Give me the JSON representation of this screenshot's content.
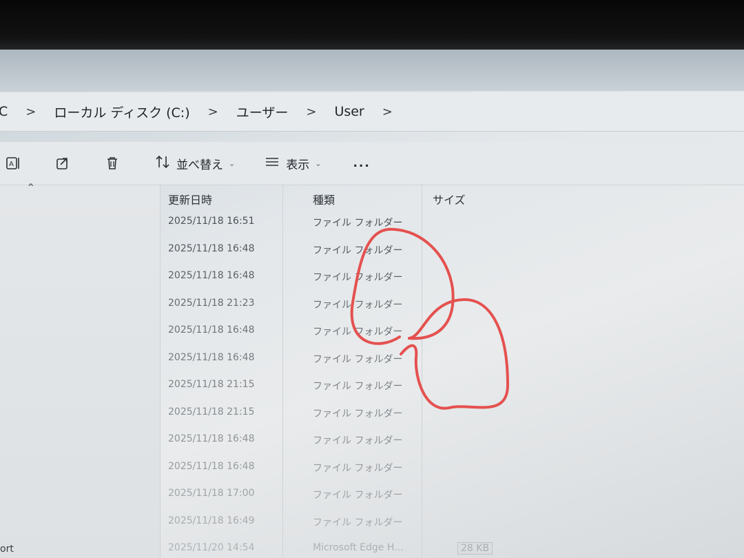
{
  "breadcrumb": {
    "items": [
      "C",
      "ローカル ディスク (C:)",
      "ユーザー",
      "User"
    ],
    "separator": ">"
  },
  "toolbar": {
    "sort_label": "並べ替え",
    "view_label": "表示",
    "more_label": "..."
  },
  "columns": {
    "modified": "更新日時",
    "type": "種類",
    "size": "サイズ"
  },
  "rows": [
    {
      "modified": "2025/11/18 16:51",
      "type": "ファイル フォルダー",
      "size": ""
    },
    {
      "modified": "2025/11/18 16:48",
      "type": "ファイル フォルダー",
      "size": ""
    },
    {
      "modified": "2025/11/18 16:48",
      "type": "ファイル フォルダー",
      "size": ""
    },
    {
      "modified": "2025/11/18 21:23",
      "type": "ファイル フォルダー",
      "size": ""
    },
    {
      "modified": "2025/11/18 16:48",
      "type": "ファイル フォルダー",
      "size": ""
    },
    {
      "modified": "2025/11/18 16:48",
      "type": "ファイル フォルダー",
      "size": ""
    },
    {
      "modified": "2025/11/18 21:15",
      "type": "ファイル フォルダー",
      "size": ""
    },
    {
      "modified": "2025/11/18 21:15",
      "type": "ファイル フォルダー",
      "size": ""
    },
    {
      "modified": "2025/11/18 16:48",
      "type": "ファイル フォルダー",
      "size": ""
    },
    {
      "modified": "2025/11/18 16:48",
      "type": "ファイル フォルダー",
      "size": ""
    },
    {
      "modified": "2025/11/18 17:00",
      "type": "ファイル フォルダー",
      "size": ""
    },
    {
      "modified": "2025/11/18 16:49",
      "type": "ファイル フォルダー",
      "size": ""
    },
    {
      "modified": "2025/11/20 14:54",
      "type": "Microsoft Edge H...",
      "size": "28 KB"
    }
  ],
  "nav": {
    "bottom_label": "ort"
  },
  "colors": {
    "annotation": "#e4514f",
    "text": "#23282d"
  },
  "icons": [
    "rename-icon",
    "share-icon",
    "delete-icon",
    "sort-icon",
    "view-icon",
    "more-icon",
    "collapse-chevron-icon"
  ]
}
